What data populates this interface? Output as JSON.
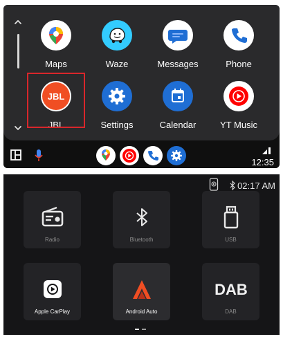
{
  "android_auto": {
    "apps": [
      {
        "label": "Maps"
      },
      {
        "label": "Waze"
      },
      {
        "label": "Messages"
      },
      {
        "label": "Phone"
      },
      {
        "label": "JBL",
        "icon_text": "JBL",
        "selected": true
      },
      {
        "label": "Settings"
      },
      {
        "label": "Calendar"
      },
      {
        "label": "YT Music"
      }
    ],
    "status": {
      "time": "12:35"
    },
    "colors": {
      "panel": "#2a2a2c",
      "selection": "#d9262b",
      "jbl": "#f04e23",
      "settings": "#1f6ed4",
      "phone": "#1f6ed4"
    }
  },
  "head_unit": {
    "status": {
      "time": "02:17 AM"
    },
    "tiles": [
      {
        "label": "Radio"
      },
      {
        "label": "Bluetooth"
      },
      {
        "label": "USB"
      },
      {
        "label": "Apple CarPlay"
      },
      {
        "label": "Android Auto"
      },
      {
        "label": "DAB",
        "icon_text": "DAB"
      }
    ],
    "colors": {
      "android_auto_accent": "#f04e23"
    }
  }
}
